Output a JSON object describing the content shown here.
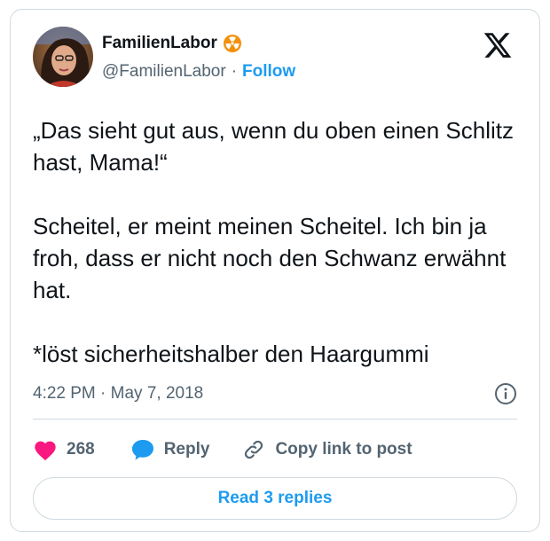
{
  "author": {
    "display_name": "FamilienLabor",
    "handle": "@FamilienLabor",
    "separator": "·",
    "follow_label": "Follow",
    "badge_icon": "radioactive-icon",
    "badge_color": "#f4900c"
  },
  "tweet": {
    "text": "„Das sieht gut aus, wenn du oben einen Schlitz hast, Mama!“\n\nScheitel, er meint meinen Scheitel. Ich bin ja froh, dass er nicht noch den Schwanz erwähnt hat.\n\n*löst sicherheitshalber den Haargummi",
    "timestamp": "4:22 PM · May 7, 2018"
  },
  "actions": {
    "like_count": "268",
    "reply_label": "Reply",
    "copy_label": "Copy link to post"
  },
  "read_replies_label": "Read 3 replies",
  "colors": {
    "accent": "#1d9bf0",
    "like": "#f91880",
    "text": "#0f1419",
    "secondary": "#536471",
    "border": "#cfd9de"
  },
  "icons": [
    "x-logo-icon",
    "info-icon",
    "heart-icon",
    "reply-bubble-icon",
    "link-icon",
    "radioactive-icon"
  ]
}
